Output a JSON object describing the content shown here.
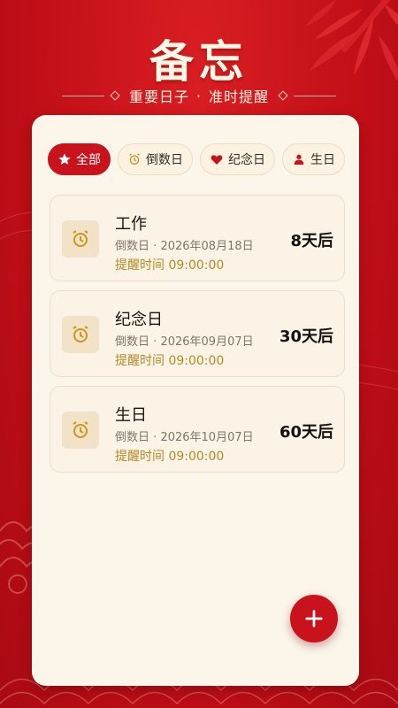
{
  "header": {
    "title": "备忘",
    "subtitle_left": "重要日子",
    "subtitle_sep": "·",
    "subtitle_right": "准时提醒"
  },
  "filters": [
    {
      "label": "全部",
      "icon": "star-icon",
      "active": true
    },
    {
      "label": "倒数日",
      "icon": "alarm-clock-icon",
      "active": false
    },
    {
      "label": "纪念日",
      "icon": "heart-icon",
      "active": false
    },
    {
      "label": "生日",
      "icon": "person-icon",
      "active": false
    }
  ],
  "items": [
    {
      "title": "工作",
      "type": "倒数日",
      "sep": "·",
      "date": "2026年08月18日",
      "remind_label": "提醒时间",
      "remind_time": "09:00:00",
      "days": "8天后",
      "icon": "alarm-clock-icon"
    },
    {
      "title": "纪念日",
      "type": "倒数日",
      "sep": "·",
      "date": "2026年09月07日",
      "remind_label": "提醒时间",
      "remind_time": "09:00:00",
      "days": "30天后",
      "icon": "alarm-clock-icon"
    },
    {
      "title": "生日",
      "type": "倒数日",
      "sep": "·",
      "date": "2026年10月07日",
      "remind_label": "提醒时间",
      "remind_time": "09:00:00",
      "days": "60天后",
      "icon": "alarm-clock-icon"
    }
  ],
  "fab": {
    "icon": "plus-icon"
  },
  "colors": {
    "brand_red": "#c8121c",
    "card_bg": "#fbf5ea",
    "gold": "#b48a2a",
    "title_cream": "#fff6e6"
  }
}
